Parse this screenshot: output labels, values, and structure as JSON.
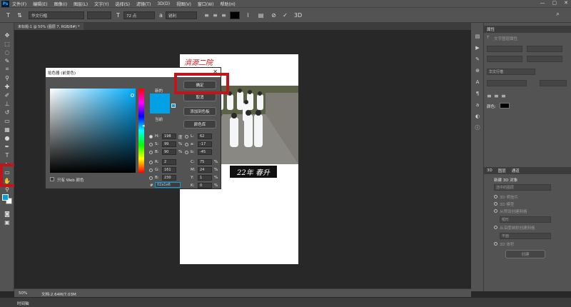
{
  "app": {
    "logo": "Ps"
  },
  "menu": [
    "文件(F)",
    "编辑(E)",
    "图像(I)",
    "图层(L)",
    "文字(Y)",
    "选择(S)",
    "滤镜(T)",
    "3D(D)",
    "视图(V)",
    "窗口(W)",
    "帮助(H)"
  ],
  "window_controls": {
    "minimize": "—",
    "restore": "▢",
    "close": "✕"
  },
  "options": {
    "font_family": "华文行楷",
    "font_size": "72 点",
    "antialias": "锐利",
    "text_color": "#000000"
  },
  "document_tab": {
    "label": "未标题-1 @ 50% (图层 7, RGB/8#) *"
  },
  "document": {
    "header_text": "濟源二院",
    "caption_text": "22年 春升"
  },
  "color_picker": {
    "title": "拾色器 (前景色)",
    "ok_label": "确定",
    "cancel_label": "取消",
    "add_swatch_label": "添加到色板",
    "libraries_label": "颜色库",
    "new_label": "新的",
    "current_label": "当前",
    "web_only_label": "只有 Web 颜色",
    "h_label": "H:",
    "h_value": "198",
    "h_unit": "度",
    "s_label": "S:",
    "s_value": "99",
    "s_unit": "%",
    "b_label": "B:",
    "b_value": "90",
    "b_unit": "%",
    "r_label": "R:",
    "r_value": "2",
    "g_label": "G:",
    "g_value": "161",
    "bl_label": "B:",
    "bl_value": "230",
    "l_label": "L:",
    "l_value": "62",
    "a_label": "a:",
    "a_value": "-17",
    "lab_b_label": "b:",
    "lab_b_value": "-45",
    "c_label": "C:",
    "c_value": "75",
    "c_unit": "%",
    "m_label": "M:",
    "m_value": "24",
    "m_unit": "%",
    "y_label": "Y:",
    "y_value": "1",
    "y_unit": "%",
    "k_label": "K:",
    "k_value": "0",
    "k_unit": "%",
    "hex_label": "#",
    "hex_value": "02a1e6",
    "color": "#02a1e6"
  },
  "properties_panel": {
    "title": "属性",
    "text_layer": "文字图层属性",
    "font": "华文行楷",
    "color_label": "颜色:"
  },
  "panel_3d": {
    "tabs": [
      "3D",
      "图层",
      "通道"
    ],
    "new_object": "新建 3D 对象",
    "source": "选中的图层",
    "postcard": "3D 明信片",
    "model": "3D 模型",
    "from_preset": "从预设创建网格",
    "preset_value": "帽形",
    "from_depth": "从深度映射创建网格",
    "depth_value": "平面",
    "volume": "3D 体积",
    "create_button": "创建"
  },
  "status": {
    "zoom": "50%",
    "doc_info": "文档:2.64M/7.03M"
  },
  "timeline": {
    "label": "时间轴"
  }
}
